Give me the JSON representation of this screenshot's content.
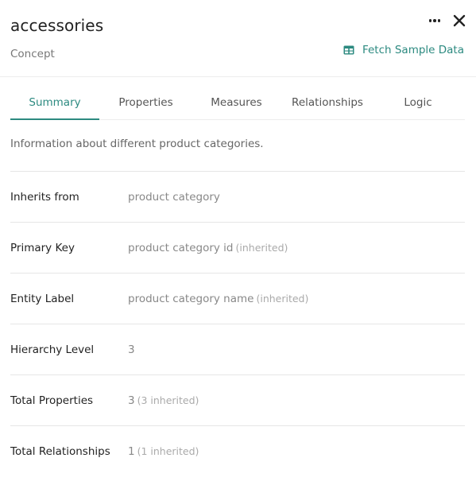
{
  "header": {
    "title": "accessories",
    "subtitle": "Concept",
    "fetch_label": "Fetch Sample Data"
  },
  "tabs": [
    {
      "label": "Summary",
      "active": true
    },
    {
      "label": "Properties"
    },
    {
      "label": "Measures"
    },
    {
      "label": "Relationships"
    },
    {
      "label": "Logic"
    }
  ],
  "summary": {
    "description": "Information about different product categories.",
    "rows": [
      {
        "label": "Inherits from",
        "value": "product category",
        "note": ""
      },
      {
        "label": "Primary Key",
        "value": "product category id",
        "note": "(inherited)"
      },
      {
        "label": "Entity Label",
        "value": "product category name",
        "note": "(inherited)"
      },
      {
        "label": "Hierarchy Level",
        "value": "3",
        "note": ""
      },
      {
        "label": "Total Properties",
        "value": "3",
        "note": "(3 inherited)"
      },
      {
        "label": "Total Relationships",
        "value": "1",
        "note": "(1 inherited)"
      }
    ]
  },
  "icons": {
    "more": "more-horizontal-icon",
    "close": "close-icon",
    "fetch": "table-icon"
  },
  "colors": {
    "accent": "#2c8a80",
    "text": "#222222",
    "muted": "#888888"
  }
}
